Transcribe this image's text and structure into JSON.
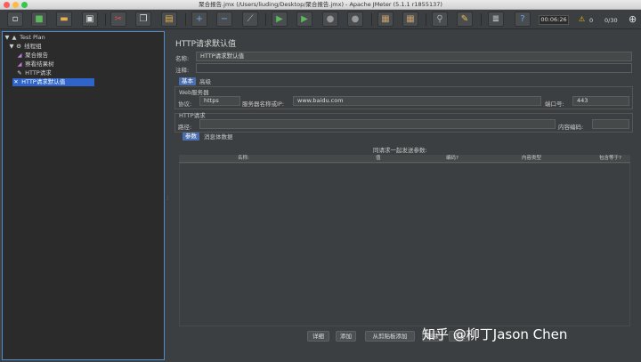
{
  "window": {
    "title": "聚合报告.jmx (/Users/liuding/Desktop/聚合报告.jmx) - Apache JMeter (5.1.1 r1855137)"
  },
  "toolbar": {
    "buttons": [
      "new-icon",
      "templates-icon",
      "open-icon",
      "save-icon",
      "cut-icon",
      "copy-icon",
      "paste-icon",
      "expand-icon",
      "collapse-icon",
      "toggle-icon",
      "start-icon",
      "start-no-pause-icon",
      "stop-icon",
      "shutdown-icon",
      "clear-icon",
      "clear-all-icon",
      "search-icon",
      "reset-search-icon",
      "function-helper-icon",
      "help-icon"
    ],
    "elapsed": "00:06:26",
    "warnings": "0",
    "threads": "0/30"
  },
  "tree": {
    "items": [
      {
        "label": "Test Plan",
        "icon": "test-plan-icon",
        "selected": false
      },
      {
        "label": "线程组",
        "icon": "thread-group-icon",
        "selected": false
      },
      {
        "label": "聚合报告",
        "icon": "listener-icon",
        "selected": false
      },
      {
        "label": "察看结果树",
        "icon": "listener-icon",
        "selected": false
      },
      {
        "label": "HTTP请求",
        "icon": "sampler-icon",
        "selected": false
      },
      {
        "label": "HTTP请求默认值",
        "icon": "config-icon",
        "selected": true
      }
    ]
  },
  "panel": {
    "title": "HTTP请求默认值",
    "name_label": "名称:",
    "name_value": "HTTP请求默认值",
    "comment_label": "注释:",
    "comment_value": "",
    "tabs": [
      "基本",
      "高级"
    ],
    "web_server_label": "Web服务器",
    "protocol_label": "协议:",
    "protocol_value": "https",
    "server_label": "服务器名称或IP:",
    "server_value": "www.baidu.com",
    "port_label": "端口号:",
    "port_value": "443",
    "http_request_label": "HTTP请求",
    "path_label": "路径:",
    "path_value": "",
    "encoding_label": "内容编码:",
    "encoding_value": "",
    "param_tabs": [
      "参数",
      "消息体数据"
    ],
    "params_caption": "同请求一起发送参数:",
    "columns": [
      "名称:",
      "值",
      "编码?",
      "内容类型",
      "包含等于?"
    ],
    "buttons": [
      "详细",
      "添加",
      "从剪贴板添加",
      "删除",
      "向上"
    ]
  },
  "watermark": "知乎 @柳丁Jason Chen"
}
